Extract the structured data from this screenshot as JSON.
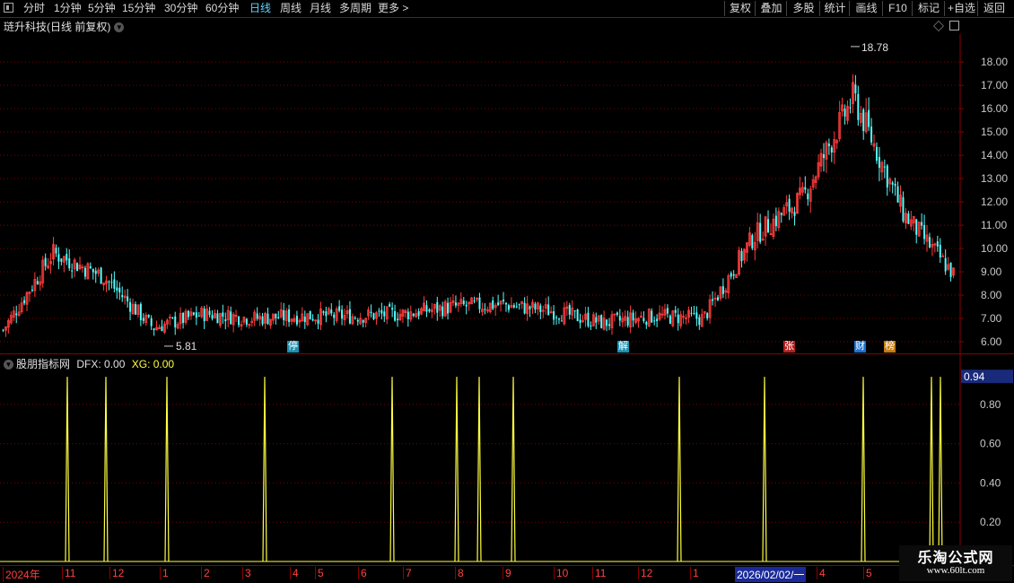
{
  "toolbar": {
    "periods": [
      "分时",
      "1分钟",
      "5分钟",
      "15分钟",
      "30分钟",
      "60分钟",
      "日线",
      "周线",
      "月线",
      "多周期",
      "更多 >"
    ],
    "active_period": "日线",
    "buttons": [
      "复权",
      "叠加",
      "多股",
      "统计",
      "画线",
      "F10",
      "标记",
      "+自选",
      "返回"
    ]
  },
  "stock": {
    "title": "琏升科技(日线 前复权)",
    "high_label": "18.78",
    "low_label": "5.81"
  },
  "price_axis": {
    "ticks": [
      "18.00",
      "17.00",
      "16.00",
      "15.00",
      "14.00",
      "13.00",
      "12.00",
      "11.00",
      "10.00",
      "9.00",
      "8.00",
      "7.00",
      "6.00"
    ]
  },
  "event_marks": [
    {
      "label": "停",
      "color": "#1c8fb0"
    },
    {
      "label": "解",
      "color": "#1c8fb0"
    },
    {
      "label": "张",
      "color": "#b02020"
    },
    {
      "label": "财",
      "color": "#1c6fd0"
    },
    {
      "label": "榜",
      "color": "#c07a10"
    }
  ],
  "indicator": {
    "title": "股朋指标网",
    "dfx_label": "DFX: 0.00",
    "xg_label": "XG: 0.00",
    "current_value": "0.94",
    "ticks": [
      "0.80",
      "0.60",
      "0.40",
      "0.20"
    ]
  },
  "date_axis": {
    "labels": [
      "2024年",
      "11",
      "12",
      "1",
      "2",
      "3",
      "4",
      "5",
      "6",
      "7",
      "8",
      "9",
      "10",
      "11",
      "12",
      "1",
      "2026/02/02/一",
      "4",
      "5"
    ]
  },
  "watermark": {
    "title": "乐淘公式网",
    "url": "www.60lt.com"
  },
  "colors": {
    "up": "#ff3c3c",
    "down": "#54ffff",
    "signal": "#ffff40",
    "grid": "#7a0000",
    "axis_text": "#c8c8c8",
    "active": "#5fd3ff"
  },
  "chart_data": [
    {
      "type": "candlestick",
      "title": "琏升科技(日线 前复权)",
      "ylim": [
        5.5,
        19.2
      ],
      "y_ticks": [
        6,
        7,
        8,
        9,
        10,
        11,
        12,
        13,
        14,
        15,
        16,
        17,
        18
      ],
      "highest": 18.78,
      "lowest": 5.81,
      "approx_close_path": [
        {
          "period": "2024-10",
          "close": 6.5
        },
        {
          "period": "2024-11",
          "close": 9.8
        },
        {
          "period": "2024-12",
          "close": 8.8
        },
        {
          "period": "2025-01",
          "close": 6.6
        },
        {
          "period": "2025-02",
          "close": 7.2
        },
        {
          "period": "2025-03",
          "close": 7.0
        },
        {
          "period": "2025-04",
          "close": 7.1
        },
        {
          "period": "2025-05",
          "close": 7.1
        },
        {
          "period": "2025-06",
          "close": 7.2
        },
        {
          "period": "2025-07",
          "close": 7.5
        },
        {
          "period": "2025-08",
          "close": 7.6
        },
        {
          "period": "2025-09",
          "close": 7.3
        },
        {
          "period": "2025-10",
          "close": 6.8
        },
        {
          "period": "2025-11",
          "close": 7.1
        },
        {
          "period": "2025-12",
          "close": 7.0
        },
        {
          "period": "2026-01",
          "close": 10.5
        },
        {
          "period": "2026-02",
          "close": 12.2
        },
        {
          "period": "2026-03",
          "close": 16.5
        },
        {
          "period": "2026-04",
          "close": 11.5
        },
        {
          "period": "2026-05",
          "close": 8.9
        }
      ]
    },
    {
      "type": "line",
      "title": "股朋指标网",
      "ylim": [
        0,
        1
      ],
      "y_ticks": [
        0.2,
        0.4,
        0.6,
        0.8
      ],
      "series": [
        {
          "name": "DFX",
          "values": [
            0.94,
            0.94,
            0.94,
            0.94,
            0.94,
            0.94,
            0.94,
            0.94,
            0.94,
            0.94,
            0.94,
            0.94,
            0.94,
            0.94,
            0.94
          ]
        }
      ],
      "spike_count": 15
    }
  ]
}
